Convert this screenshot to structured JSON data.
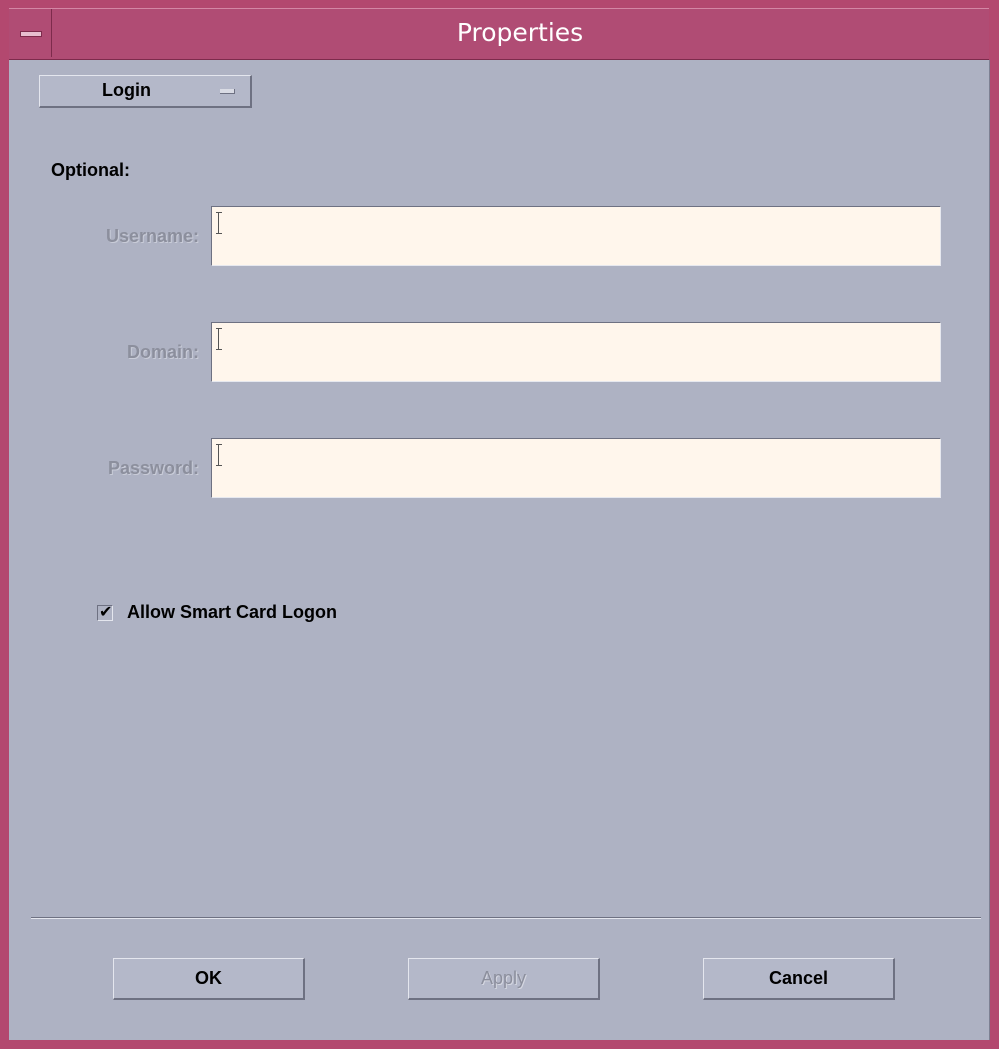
{
  "window": {
    "title": "Properties"
  },
  "page_menu": {
    "selected": "Login"
  },
  "form": {
    "section_label": "Optional:",
    "username": {
      "label": "Username:",
      "value": ""
    },
    "domain": {
      "label": "Domain:",
      "value": ""
    },
    "password": {
      "label": "Password:",
      "value": ""
    },
    "smart_card": {
      "label": "Allow Smart Card Logon",
      "checked": true
    }
  },
  "buttons": {
    "ok": "OK",
    "apply": "Apply",
    "cancel": "Cancel"
  },
  "colors": {
    "titlebar": "#b04c74",
    "background": "#aeb2c3",
    "field": "#fff6ec"
  }
}
